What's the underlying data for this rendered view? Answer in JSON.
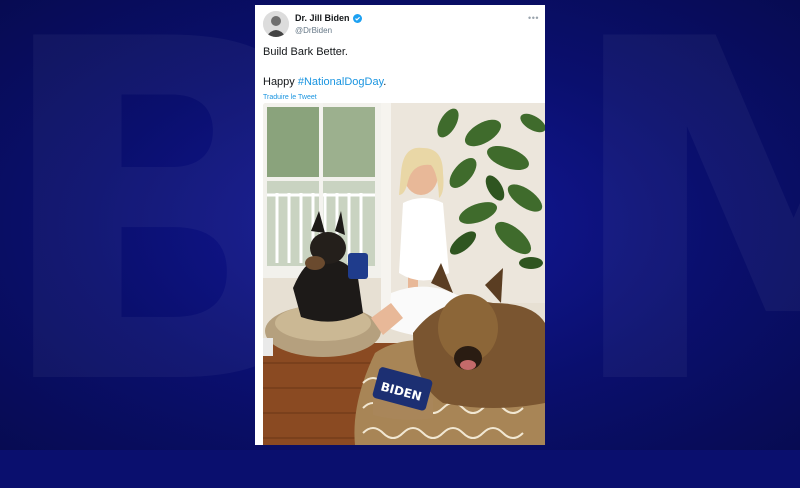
{
  "background": {
    "brand_watermark": "BFM"
  },
  "tweet": {
    "display_name": "Dr. Jill Biden",
    "handle": "@DrBiden",
    "more_glyph": "•••",
    "text_line1": "Build Bark Better.",
    "text_line2_prefix": "Happy ",
    "hashtag": "#NationalDogDay",
    "text_line2_suffix": ".",
    "translate_label": "Traduire le Tweet",
    "photo_pillow_text": "BIDEN"
  },
  "colors": {
    "accent_link": "#1b95e0",
    "background_blue": "#0a0f6e",
    "verified_badge": "#1da1f2"
  }
}
